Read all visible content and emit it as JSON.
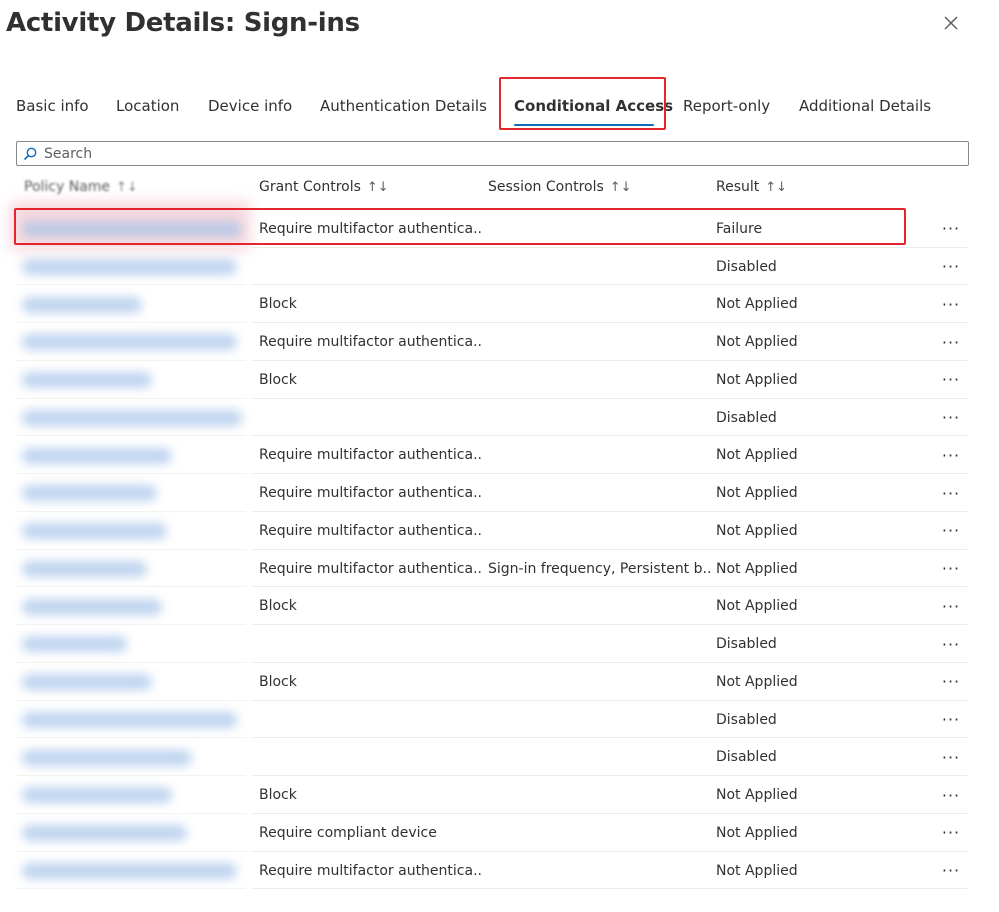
{
  "panel": {
    "title": "Activity Details: Sign-ins"
  },
  "tabs": [
    {
      "label": "Basic info",
      "active": false
    },
    {
      "label": "Location",
      "active": false
    },
    {
      "label": "Device info",
      "active": false
    },
    {
      "label": "Authentication Details",
      "active": false
    },
    {
      "label": "Conditional Access",
      "active": true
    },
    {
      "label": "Report-only",
      "active": false
    },
    {
      "label": "Additional Details",
      "active": false
    }
  ],
  "search": {
    "placeholder": "Search",
    "value": ""
  },
  "table": {
    "columns": [
      "Policy Name",
      "Grant Controls",
      "Session Controls",
      "Result"
    ],
    "sort_glyph": "↑↓",
    "more_glyph": "···",
    "rows": [
      {
        "grant": "Require multifactor authentica...",
        "session": "",
        "result": "Failure"
      },
      {
        "grant": "",
        "session": "",
        "result": "Disabled"
      },
      {
        "grant": "Block",
        "session": "",
        "result": "Not Applied"
      },
      {
        "grant": "Require multifactor authentica...",
        "session": "",
        "result": "Not Applied"
      },
      {
        "grant": "Block",
        "session": "",
        "result": "Not Applied"
      },
      {
        "grant": "",
        "session": "",
        "result": "Disabled"
      },
      {
        "grant": "Require multifactor authentica...",
        "session": "",
        "result": "Not Applied"
      },
      {
        "grant": "Require multifactor authentica...",
        "session": "",
        "result": "Not Applied"
      },
      {
        "grant": "Require multifactor authentica...",
        "session": "",
        "result": "Not Applied"
      },
      {
        "grant": "Require multifactor authentica...",
        "session": "Sign-in frequency, Persistent b...",
        "result": "Not Applied"
      },
      {
        "grant": "Block",
        "session": "",
        "result": "Not Applied"
      },
      {
        "grant": "",
        "session": "",
        "result": "Disabled"
      },
      {
        "grant": "Block",
        "session": "",
        "result": "Not Applied"
      },
      {
        "grant": "",
        "session": "",
        "result": "Disabled"
      },
      {
        "grant": "",
        "session": "",
        "result": "Disabled"
      },
      {
        "grant": "Block",
        "session": "",
        "result": "Not Applied"
      },
      {
        "grant": "Require compliant device",
        "session": "",
        "result": "Not Applied"
      },
      {
        "grant": "Require multifactor authentica...",
        "session": "",
        "result": "Not Applied"
      }
    ]
  },
  "colors": {
    "accent": "#0f6cbd",
    "highlight": "#e3262e"
  },
  "icons": {
    "close": "close-icon",
    "search": "search-icon",
    "more": "more-icon"
  }
}
